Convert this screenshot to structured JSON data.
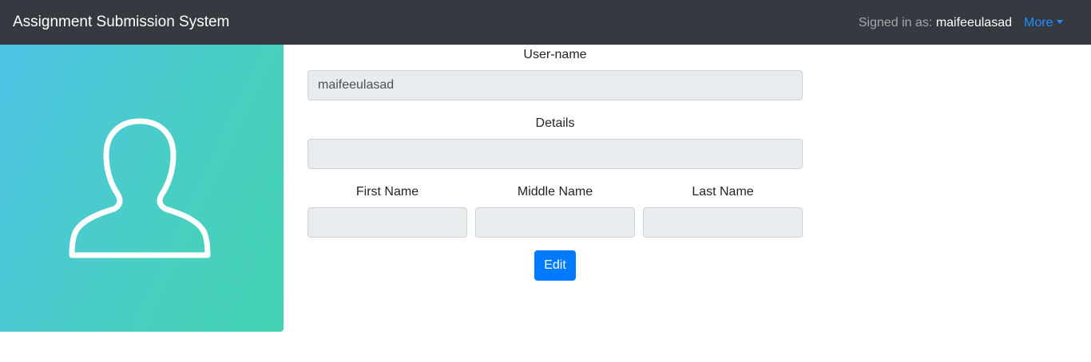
{
  "navbar": {
    "brand": "Assignment Submission System",
    "signed_in_prefix": "Signed in as:",
    "signed_in_user": "maifeeulasad",
    "more_label": "More"
  },
  "avatar": {
    "icon": "user-outline-icon",
    "gradient_colors": [
      "#4fc3e6",
      "#45d3b2"
    ]
  },
  "form": {
    "username_label": "User-name",
    "username_value": "maifeeulasad",
    "details_label": "Details",
    "details_value": "",
    "first_name_label": "First Name",
    "first_name_value": "",
    "middle_name_label": "Middle Name",
    "middle_name_value": "",
    "last_name_label": "Last Name",
    "last_name_value": "",
    "edit_label": "Edit"
  },
  "colors": {
    "navbar_bg": "#343a40",
    "accent": "#007bff",
    "input_bg": "#e9ecef"
  }
}
